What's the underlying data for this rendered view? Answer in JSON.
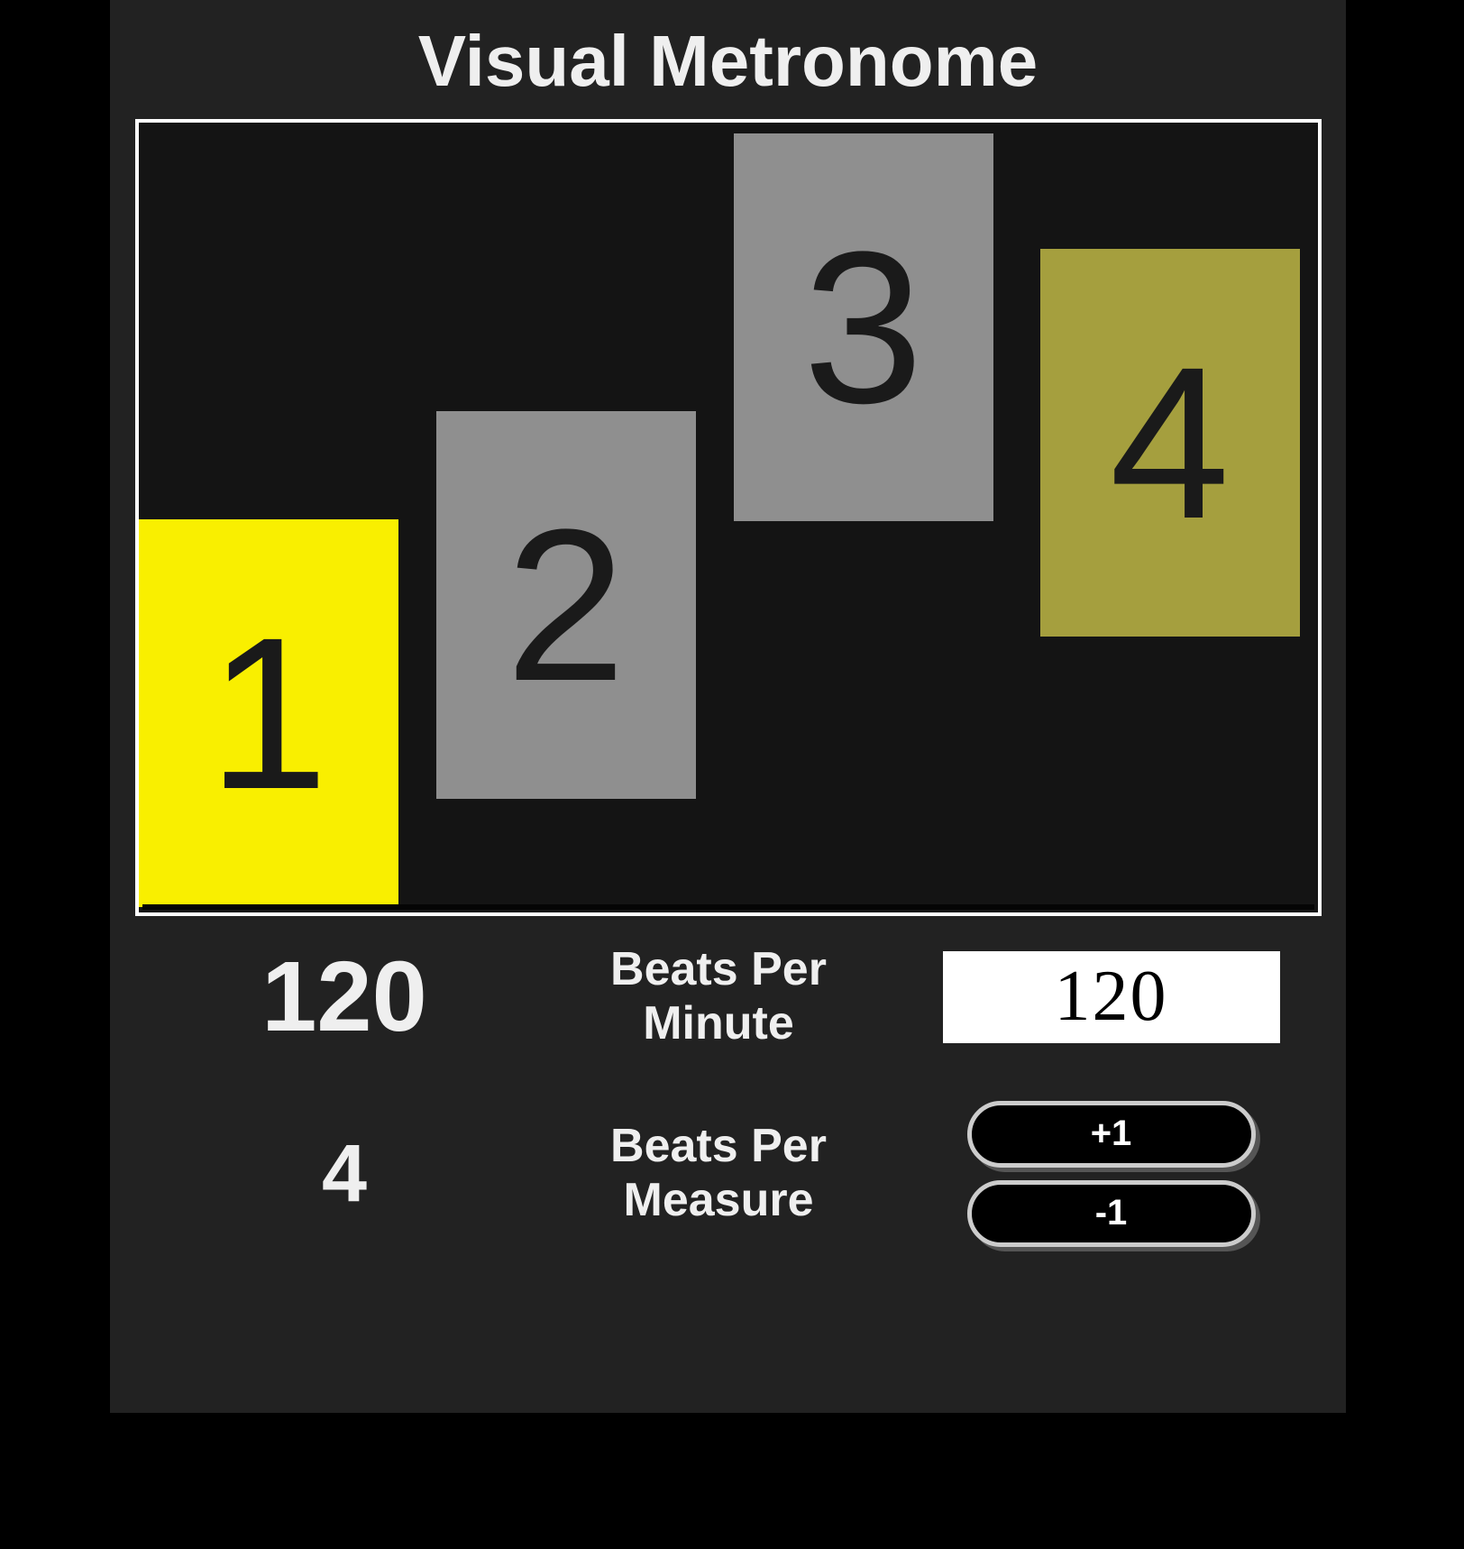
{
  "title": "Visual Metronome",
  "beats": {
    "labels": [
      "1",
      "2",
      "3",
      "4"
    ],
    "colors": {
      "active": "#f9ef00",
      "idle": "#8f8f8f",
      "accent": "#a59f3e"
    }
  },
  "bpm": {
    "value_display": "120",
    "label_line1": "Beats Per",
    "label_line2": "Minute",
    "input_value": "120"
  },
  "bpMeasure": {
    "value_display": "4",
    "label_line1": "Beats Per",
    "label_line2": "Measure",
    "inc_label": "+1",
    "dec_label": "-1"
  }
}
